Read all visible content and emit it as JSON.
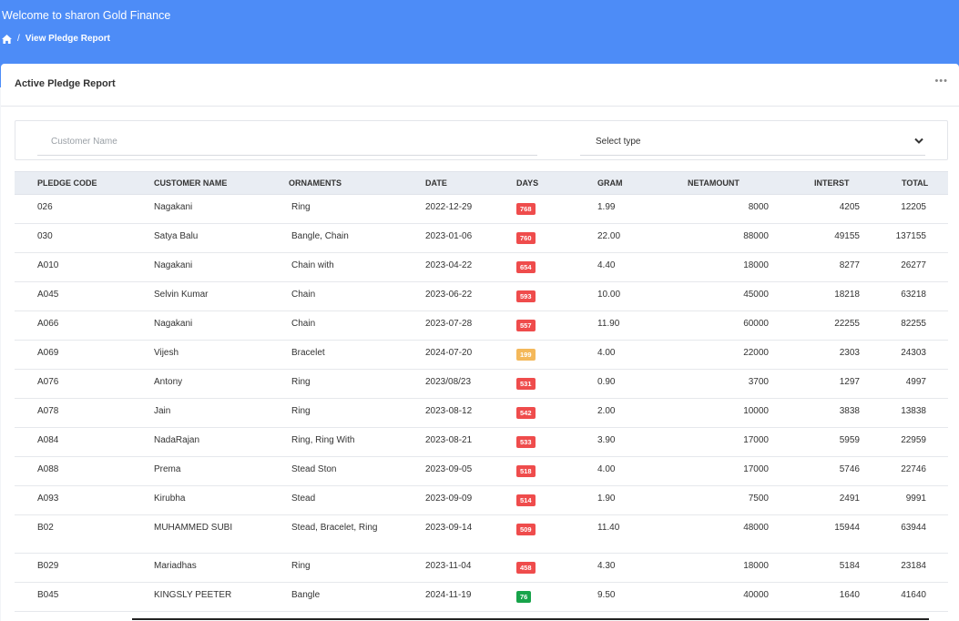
{
  "header": {
    "welcome": "Welcome to sharon Gold Finance",
    "breadcrumb": "View Pledge Report",
    "breadcrumb_sep": "/",
    "home_icon": "home-icon",
    "color": "#4d8cf7"
  },
  "card": {
    "title": "Active Pledge Report",
    "more": "•••"
  },
  "filters": {
    "customer_placeholder": "Customer Name",
    "customer_value": "",
    "type_select": "Select type"
  },
  "table": {
    "headers": [
      "PLEDGE CODE",
      "CUSTOMER NAME",
      "ORNAMENTS",
      "DATE",
      "DAYS",
      "GRAM",
      "NETAMOUNT",
      "INTERST",
      "TOTAL"
    ],
    "rows": [
      {
        "code": "026",
        "name": "Nagakani",
        "ornaments": "Ring",
        "date": "2022-12-29",
        "days": "768",
        "badge": "red",
        "gram": "1.99",
        "net": "8000",
        "interest": "4205",
        "total": "12205"
      },
      {
        "code": "030",
        "name": "Satya Balu",
        "ornaments": "Bangle, Chain",
        "date": "2023-01-06",
        "days": "760",
        "badge": "red",
        "gram": "22.00",
        "net": "88000",
        "interest": "49155",
        "total": "137155"
      },
      {
        "code": "A010",
        "name": "Nagakani",
        "ornaments": "Chain with",
        "date": "2023-04-22",
        "days": "654",
        "badge": "red",
        "gram": "4.40",
        "net": "18000",
        "interest": "8277",
        "total": "26277"
      },
      {
        "code": "A045",
        "name": "Selvin Kumar",
        "ornaments": "Chain",
        "date": "2023-06-22",
        "days": "593",
        "badge": "red",
        "gram": "10.00",
        "net": "45000",
        "interest": "18218",
        "total": "63218"
      },
      {
        "code": "A066",
        "name": "Nagakani",
        "ornaments": "Chain",
        "date": "2023-07-28",
        "days": "557",
        "badge": "red",
        "gram": "11.90",
        "net": "60000",
        "interest": "22255",
        "total": "82255"
      },
      {
        "code": "A069",
        "name": "Vijesh",
        "ornaments": "Bracelet",
        "date": "2024-07-20",
        "days": "199",
        "badge": "amber",
        "gram": "4.00",
        "net": "22000",
        "interest": "2303",
        "total": "24303"
      },
      {
        "code": "A076",
        "name": "Antony",
        "ornaments": "Ring",
        "date": "2023/08/23",
        "days": "531",
        "badge": "red",
        "gram": "0.90",
        "net": "3700",
        "interest": "1297",
        "total": "4997"
      },
      {
        "code": "A078",
        "name": "Jain",
        "ornaments": "Ring",
        "date": "2023-08-12",
        "days": "542",
        "badge": "red",
        "gram": "2.00",
        "net": "10000",
        "interest": "3838",
        "total": "13838"
      },
      {
        "code": "A084",
        "name": "NadaRajan",
        "ornaments": "Ring, Ring With",
        "date": "2023-08-21",
        "days": "533",
        "badge": "red",
        "gram": "3.90",
        "net": "17000",
        "interest": "5959",
        "total": "22959"
      },
      {
        "code": "A088",
        "name": "Prema",
        "ornaments": "Stead Ston",
        "date": "2023-09-05",
        "days": "518",
        "badge": "red",
        "gram": "4.00",
        "net": "17000",
        "interest": "5746",
        "total": "22746"
      },
      {
        "code": "A093",
        "name": "Kirubha",
        "ornaments": "Stead",
        "date": "2023-09-09",
        "days": "514",
        "badge": "red",
        "gram": "1.90",
        "net": "7500",
        "interest": "2491",
        "total": "9991"
      },
      {
        "code": "B02",
        "name": "MUHAMMED SUBI",
        "ornaments": "Stead, Bracelet, Ring",
        "date": "2023-09-14",
        "days": "509",
        "badge": "red",
        "gram": "11.40",
        "net": "48000",
        "interest": "15944",
        "total": "63944",
        "tall": true
      },
      {
        "code": "B029",
        "name": "Mariadhas",
        "ornaments": "Ring",
        "date": "2023-11-04",
        "days": "458",
        "badge": "red",
        "gram": "4.30",
        "net": "18000",
        "interest": "5184",
        "total": "23184"
      },
      {
        "code": "B045",
        "name": "KINGSLY PEETER",
        "ornaments": "Bangle",
        "date": "2024-11-19",
        "days": "76",
        "badge": "green",
        "gram": "9.50",
        "net": "40000",
        "interest": "1640",
        "total": "41640"
      }
    ]
  },
  "colors": {
    "badge_red": "#ef4c4c",
    "badge_amber": "#f4b85a",
    "badge_green": "#17a34a"
  }
}
